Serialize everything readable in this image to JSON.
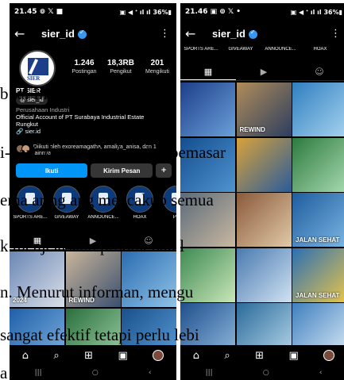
{
  "left": {
    "status": {
      "time": "21.45",
      "icons_left": "⊚ 𝕏 ■",
      "icons_right": "▣ ◀ ᐩ ıl ıl 36%▮"
    },
    "topbar": {
      "username": "sier_id"
    },
    "stats": [
      {
        "value": "1.246",
        "label": "Postingan"
      },
      {
        "value": "18,3RB",
        "label": "Pengikut"
      },
      {
        "value": "201",
        "label": "Mengikuti"
      }
    ],
    "avatar_text": "SIER",
    "bio": {
      "name": "PT SIER",
      "threads": "sier_id",
      "category": "Perusahaan Industri",
      "line1": "Official Account of PT Surabaya Industrial Estate",
      "line2": "Rungkut",
      "link": "sier.id",
      "followed_by": "Diikuti oleh exoreamagatha, amaliya_anisa, dan 1 lainnya"
    },
    "buttons": {
      "follow": "Ikuti",
      "message": "Kirim Pesan",
      "add": "+"
    },
    "highlights": [
      "SPORTS ARE...",
      "GIVEAWAY",
      "ANNOUNCE...",
      "HOAX",
      "PR"
    ],
    "grid_captions": [
      "2024",
      "REWIND",
      ""
    ]
  },
  "right": {
    "status": {
      "time": "21.46",
      "icons_left": "▣ ⊚ 𝕏 •",
      "icons_right": "▣ ◀ ᐩ ıl ıl 36%▮"
    },
    "topbar": {
      "username": "sier_id"
    },
    "highlights": [
      "SPORTS ARE...",
      "GIVEAWAY",
      "ANNOUNCE...",
      "HOAX"
    ],
    "grid_captions": [
      "",
      "REWIND",
      "",
      "",
      "",
      "",
      "",
      "",
      "JALAN SEHAT",
      "",
      "",
      "JALAN SEHAT",
      "",
      "",
      ""
    ]
  },
  "overlay_text": [
    "b          ial Instagram PT",
    "i-hari, dan penjualan dan pemasar",
    "ema ar ng ang mencakup semua",
    "k menjelaskan produk dan l",
    "n. Menurut informan, mengu",
    "sangat efektif tetapi perlu lebi",
    "a"
  ]
}
